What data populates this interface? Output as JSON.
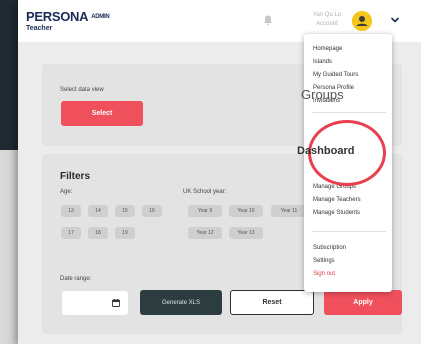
{
  "header": {
    "brand": "PERSONA",
    "brand_tag": "ADMIN",
    "role": "Teacher",
    "user_line1": "Yan Qu Lu",
    "user_line2": "Account",
    "bell_icon": "bell-icon",
    "avatar_icon": "user-avatar-icon",
    "menu_icon": "chevron-down-icon"
  },
  "data_view": {
    "label": "Select data view",
    "select_button": "Select"
  },
  "filters": {
    "title": "Filters",
    "age_label": "Age:",
    "ages": [
      "13",
      "14",
      "15",
      "16",
      "17",
      "18",
      "19"
    ],
    "school_year_label": "UK School year:",
    "school_years": [
      "Year 9",
      "Year 10",
      "Year 11",
      "Year 12",
      "Year 13"
    ],
    "date_range_label": "Date range:",
    "calendar_icon": "calendar-icon",
    "generate_button": "Generate XLS",
    "reset_button": "Reset",
    "apply_button": "Apply"
  },
  "menu": {
    "items_top": [
      "Homepage",
      "Islands",
      "My Guided Tours",
      "Persona Profile",
      "Invitations"
    ],
    "zoom_groups": "Groups",
    "zoom_dashboard": "Dashboard",
    "items_mid": [
      "Manage Groups",
      "Manage Teachers",
      "Manage Students"
    ],
    "items_bottom": [
      "Subscription",
      "Settings"
    ],
    "sign_out": "Sign out"
  },
  "colors": {
    "accent_red": "#f04f5c",
    "brand_navy": "#1b2b57",
    "dark_button": "#2d3d3f",
    "avatar_yellow": "#f5c518"
  }
}
